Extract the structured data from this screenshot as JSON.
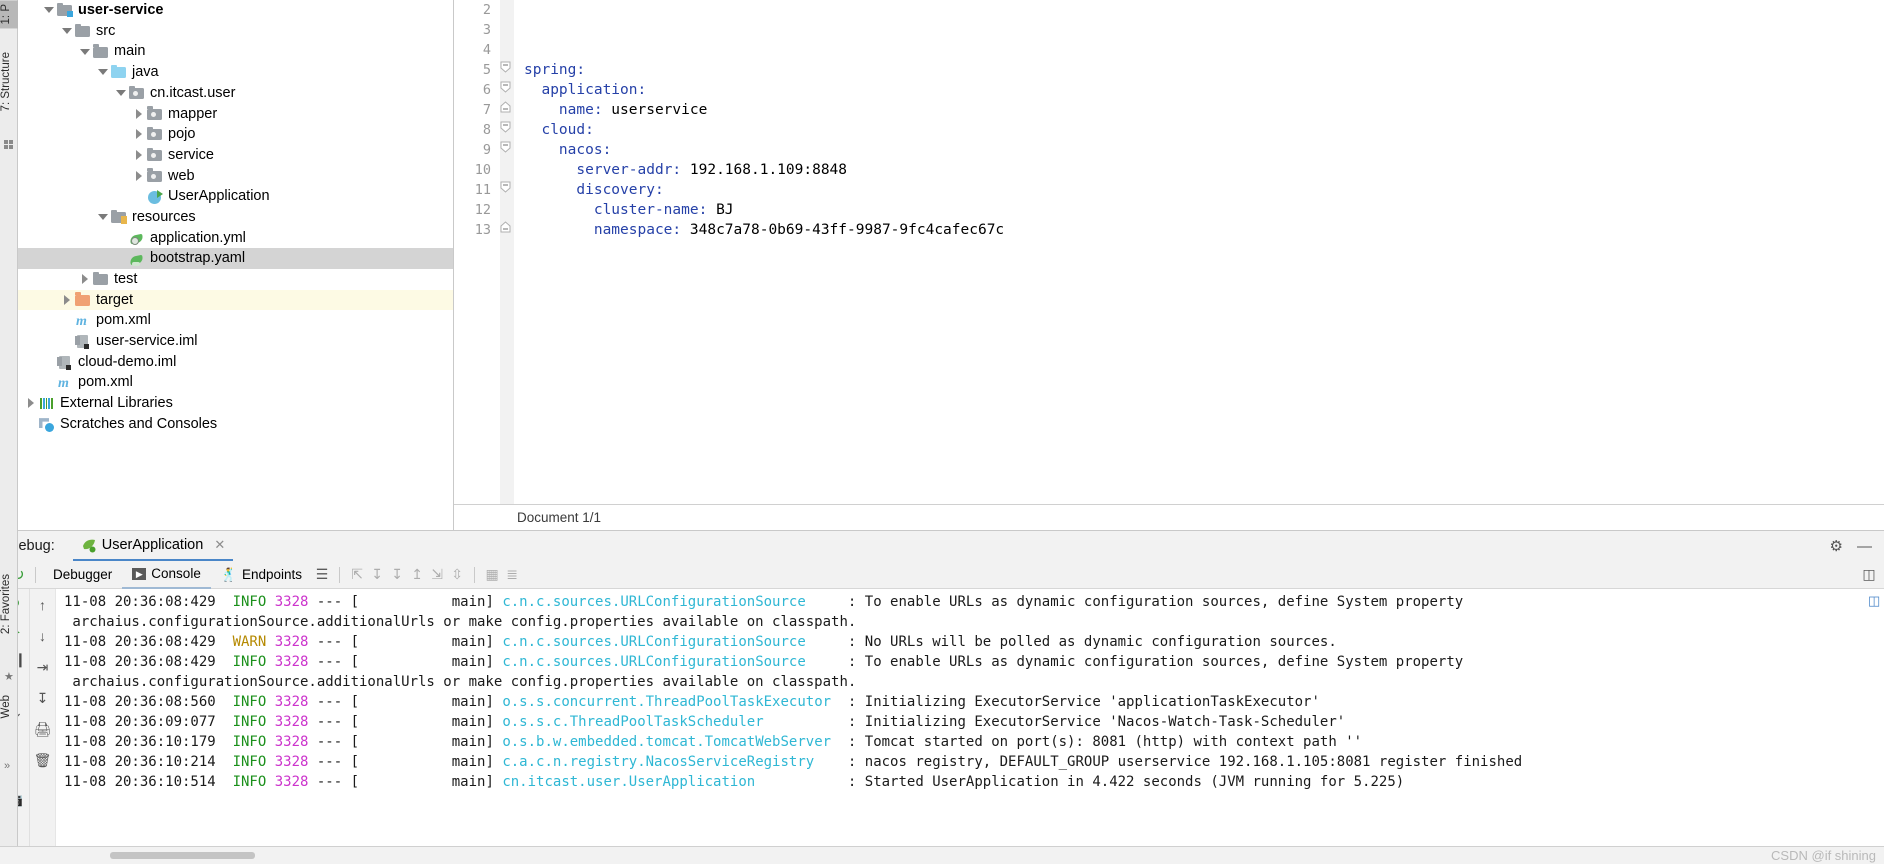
{
  "left_rail_top": {
    "tabs": [
      {
        "label": "1: P",
        "name": "tool-window-project"
      },
      {
        "label": "7: Structure",
        "name": "tool-window-structure"
      }
    ],
    "dots_icon": "grid-dots-icon"
  },
  "left_rail_bottom": {
    "favorites_label": "2: Favorites",
    "web_label": "Web",
    "star_icon": "star-icon",
    "chevrons_icon": "chevrons-right-icon"
  },
  "project_tree": {
    "items": [
      {
        "label": "user-service",
        "depth": 1,
        "twist": "open",
        "icon": "folder-module-icon",
        "bold": true,
        "state": "normal"
      },
      {
        "label": "src",
        "depth": 2,
        "twist": "open",
        "icon": "folder-icon",
        "bold": false,
        "state": "normal"
      },
      {
        "label": "main",
        "depth": 3,
        "twist": "open",
        "icon": "folder-icon",
        "bold": false,
        "state": "normal"
      },
      {
        "label": "java",
        "depth": 4,
        "twist": "open",
        "icon": "folder-java-icon",
        "bold": false,
        "state": "normal"
      },
      {
        "label": "cn.itcast.user",
        "depth": 5,
        "twist": "open",
        "icon": "folder-package-icon",
        "bold": false,
        "state": "normal"
      },
      {
        "label": "mapper",
        "depth": 6,
        "twist": "closed",
        "icon": "folder-package-icon",
        "bold": false,
        "state": "normal"
      },
      {
        "label": "pojo",
        "depth": 6,
        "twist": "closed",
        "icon": "folder-package-icon",
        "bold": false,
        "state": "normal"
      },
      {
        "label": "service",
        "depth": 6,
        "twist": "closed",
        "icon": "folder-package-icon",
        "bold": false,
        "state": "normal"
      },
      {
        "label": "web",
        "depth": 6,
        "twist": "closed",
        "icon": "folder-package-icon",
        "bold": false,
        "state": "normal"
      },
      {
        "label": "UserApplication",
        "depth": 6,
        "twist": "none",
        "icon": "java-class-run-icon",
        "bold": false,
        "state": "normal"
      },
      {
        "label": "resources",
        "depth": 4,
        "twist": "open",
        "icon": "folder-resources-icon",
        "bold": false,
        "state": "normal"
      },
      {
        "label": "application.yml",
        "depth": 5,
        "twist": "none",
        "icon": "yaml-config-icon",
        "bold": false,
        "state": "normal"
      },
      {
        "label": "bootstrap.yaml",
        "depth": 5,
        "twist": "none",
        "icon": "yaml-cloud-icon",
        "bold": false,
        "state": "selected"
      },
      {
        "label": "test",
        "depth": 3,
        "twist": "closed",
        "icon": "folder-icon",
        "bold": false,
        "state": "normal"
      },
      {
        "label": "target",
        "depth": 2,
        "twist": "closed",
        "icon": "folder-target-icon",
        "bold": false,
        "state": "marked"
      },
      {
        "label": "pom.xml",
        "depth": 2,
        "twist": "none",
        "icon": "maven-icon",
        "bold": false,
        "state": "normal"
      },
      {
        "label": "user-service.iml",
        "depth": 2,
        "twist": "none",
        "icon": "iml-icon",
        "bold": false,
        "state": "normal"
      },
      {
        "label": "cloud-demo.iml",
        "depth": 1,
        "twist": "none",
        "icon": "iml-icon",
        "bold": false,
        "state": "normal"
      },
      {
        "label": "pom.xml",
        "depth": 1,
        "twist": "none",
        "icon": "maven-icon",
        "bold": false,
        "state": "normal"
      },
      {
        "label": "External Libraries",
        "depth": 0,
        "twist": "closed",
        "icon": "libraries-icon",
        "bold": false,
        "state": "normal"
      },
      {
        "label": "Scratches and Consoles",
        "depth": 0,
        "twist": "none",
        "icon": "scratches-icon",
        "bold": false,
        "state": "normal"
      }
    ]
  },
  "editor": {
    "lines": [
      {
        "num": "2",
        "indent": 0,
        "key": "",
        "sep": "",
        "value": "",
        "fold": "none"
      },
      {
        "num": "3",
        "indent": 0,
        "key": "",
        "sep": "",
        "value": "",
        "fold": "none"
      },
      {
        "num": "4",
        "indent": 0,
        "key": "",
        "sep": "",
        "value": "",
        "fold": "none"
      },
      {
        "num": "5",
        "indent": 0,
        "key": "spring",
        "sep": ":",
        "value": "",
        "fold": "open"
      },
      {
        "num": "6",
        "indent": 2,
        "key": "application",
        "sep": ":",
        "value": "",
        "fold": "open"
      },
      {
        "num": "7",
        "indent": 4,
        "key": "name",
        "sep": ":",
        "value": " userservice",
        "fold": "end"
      },
      {
        "num": "8",
        "indent": 2,
        "key": "cloud",
        "sep": ":",
        "value": "",
        "fold": "open"
      },
      {
        "num": "9",
        "indent": 4,
        "key": "nacos",
        "sep": ":",
        "value": "",
        "fold": "open"
      },
      {
        "num": "10",
        "indent": 6,
        "key": "server-addr",
        "sep": ":",
        "value": " 192.168.1.109:8848",
        "fold": "none"
      },
      {
        "num": "11",
        "indent": 6,
        "key": "discovery",
        "sep": ":",
        "value": "",
        "fold": "open"
      },
      {
        "num": "12",
        "indent": 8,
        "key": "cluster-name",
        "sep": ":",
        "value": " BJ",
        "fold": "none"
      },
      {
        "num": "13",
        "indent": 8,
        "key": "namespace",
        "sep": ":",
        "value": " 348c7a78-0b69-43ff-9987-9fc4cafec67c",
        "fold": "end"
      }
    ],
    "statusbar": "Document 1/1"
  },
  "debug": {
    "header_label": "Debug:",
    "session_tab": "UserApplication",
    "session_icon": "spring-boot-run-icon",
    "close_icon": "close-icon",
    "gear_icon": "gear-icon",
    "minimize_icon": "minimize-icon",
    "tabs": [
      {
        "label": "Debugger",
        "icon": "debugger-icon",
        "active": false
      },
      {
        "label": "Console",
        "icon": "console-icon",
        "active": true
      },
      {
        "label": "Endpoints",
        "icon": "endpoints-icon",
        "active": false
      }
    ],
    "toolbar_icons": [
      "layout-icon",
      "step-over-icon",
      "step-into-icon",
      "force-step-into-icon",
      "step-out-icon",
      "drop-frame-icon",
      "run-to-cursor-icon",
      "evaluate-expression-icon",
      "settings-toolbar-icon"
    ],
    "run_strip_icons": [
      "rerun-icon",
      "resume-icon",
      "pause-icon",
      "stop-icon",
      "restore-layout-icon",
      "soft-wrap-icon",
      "scroll-to-end-icon",
      "print-icon",
      "clear-all-icon"
    ],
    "side_strip_icons": [
      "up-arrow-icon",
      "down-arrow-icon",
      "soft-wrap-icon",
      "scroll-end-icon",
      "print-icon",
      "trash-icon"
    ],
    "console_right_icon": "split-console-icon"
  },
  "console": {
    "lines": [
      {
        "type": "log",
        "time": "11-08 20:36:08:429",
        "level": "INFO",
        "pid": "3328",
        "thread": "main",
        "logger": "c.n.c.sources.URLConfigurationSource",
        "message": ": To enable URLs as dynamic configuration sources, define System property"
      },
      {
        "type": "cont",
        "text": "archaius.configurationSource.additionalUrls or make config.properties available on classpath."
      },
      {
        "type": "log",
        "time": "11-08 20:36:08:429",
        "level": "WARN",
        "pid": "3328",
        "thread": "main",
        "logger": "c.n.c.sources.URLConfigurationSource",
        "message": ": No URLs will be polled as dynamic configuration sources."
      },
      {
        "type": "log",
        "time": "11-08 20:36:08:429",
        "level": "INFO",
        "pid": "3328",
        "thread": "main",
        "logger": "c.n.c.sources.URLConfigurationSource",
        "message": ": To enable URLs as dynamic configuration sources, define System property"
      },
      {
        "type": "cont",
        "text": "archaius.configurationSource.additionalUrls or make config.properties available on classpath."
      },
      {
        "type": "log",
        "time": "11-08 20:36:08:560",
        "level": "INFO",
        "pid": "3328",
        "thread": "main",
        "logger": "o.s.s.concurrent.ThreadPoolTaskExecutor",
        "message": ": Initializing ExecutorService 'applicationTaskExecutor'"
      },
      {
        "type": "log",
        "time": "11-08 20:36:09:077",
        "level": "INFO",
        "pid": "3328",
        "thread": "main",
        "logger": "o.s.s.c.ThreadPoolTaskScheduler",
        "message": ": Initializing ExecutorService 'Nacos-Watch-Task-Scheduler'"
      },
      {
        "type": "log",
        "time": "11-08 20:36:10:179",
        "level": "INFO",
        "pid": "3328",
        "thread": "main",
        "logger": "o.s.b.w.embedded.tomcat.TomcatWebServer",
        "message": ": Tomcat started on port(s): 8081 (http) with context path ''"
      },
      {
        "type": "log",
        "time": "11-08 20:36:10:214",
        "level": "INFO",
        "pid": "3328",
        "thread": "main",
        "logger": "c.a.c.n.registry.NacosServiceRegistry",
        "message": ": nacos registry, DEFAULT_GROUP userservice 192.168.1.105:8081 register finished"
      },
      {
        "type": "log",
        "time": "11-08 20:36:10:514",
        "level": "INFO",
        "pid": "3328",
        "thread": "main",
        "logger": "cn.itcast.user.UserApplication",
        "message": ": Started UserApplication in 4.422 seconds (JVM running for 5.225)"
      }
    ]
  },
  "statusbar": {
    "watermark": "CSDN @if shining"
  },
  "colors": {
    "info": "#1a8f1a",
    "warn": "#b58900",
    "pid": "#cc33cc",
    "logger": "#2fb7d4",
    "yaml_key": "#2641a8",
    "selection": "#d4d4d4",
    "marked_row": "#fdfae4",
    "accent_tab": "#4a86c8"
  }
}
